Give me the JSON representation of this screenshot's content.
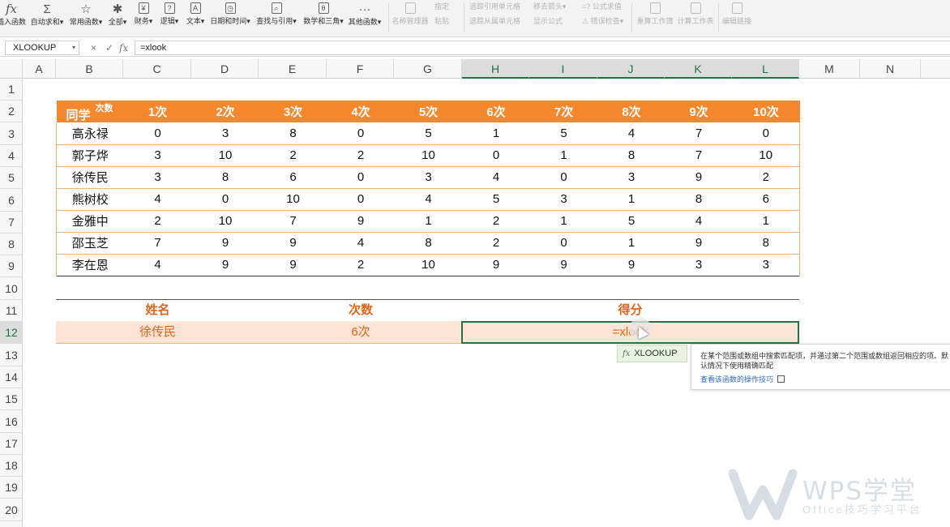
{
  "ribbon": {
    "items": [
      {
        "id": "insert_fn",
        "icon": "fx",
        "label": "插入函数"
      },
      {
        "id": "autosum",
        "icon": "Σ",
        "label": "自动求和▾"
      },
      {
        "id": "common",
        "icon": "☆",
        "label": "常用函数▾"
      },
      {
        "id": "all",
        "icon": "✱",
        "label": "全部▾"
      },
      {
        "id": "finance",
        "icon": "¥",
        "label": "财务▾"
      },
      {
        "id": "logic",
        "icon": "?",
        "label": "逻辑▾"
      },
      {
        "id": "text",
        "icon": "A",
        "label": "文本▾"
      },
      {
        "id": "datetime",
        "icon": "◷",
        "label": "日期和时间▾"
      },
      {
        "id": "lookup",
        "icon": "⌕",
        "label": "查找与引用▾"
      },
      {
        "id": "math",
        "icon": "θ",
        "label": "数学和三角▾"
      },
      {
        "id": "other",
        "icon": "···",
        "label": "其他函数▾"
      }
    ],
    "disabled": [
      {
        "id": "name_mgr",
        "label": "名称管理器"
      },
      {
        "id": "recalc",
        "label": "重算工作簿"
      },
      {
        "id": "calc_sheet",
        "label": "计算工作表"
      },
      {
        "id": "edit_links",
        "label": "编辑链接"
      }
    ],
    "small": {
      "specify": "指定",
      "paste": "粘贴",
      "trace_prec": "追踪引用单元格",
      "trace_dep": "追踪从属单元格",
      "remove_arrows": "移去箭头▾",
      "show_formula": "显示公式",
      "eval_formula": "=? 公式求值",
      "error_check": "⚠ 错误检查▾"
    }
  },
  "formula_bar": {
    "name_box": "XLOOKUP",
    "cancel": "×",
    "confirm": "✓",
    "fx": "fx",
    "formula": "=xlook"
  },
  "columns": [
    "A",
    "B",
    "C",
    "D",
    "E",
    "F",
    "G",
    "H",
    "I",
    "J",
    "K",
    "L",
    "M",
    "N"
  ],
  "rows": [
    "1",
    "2",
    "3",
    "4",
    "5",
    "6",
    "7",
    "8",
    "9",
    "10",
    "11",
    "12",
    "13",
    "14",
    "15",
    "16",
    "17",
    "18",
    "19",
    "20"
  ],
  "table": {
    "corner_main": "同学",
    "corner_sub": "次数",
    "headers": [
      "1次",
      "2次",
      "3次",
      "4次",
      "5次",
      "6次",
      "7次",
      "8次",
      "9次",
      "10次"
    ],
    "rows": [
      {
        "name": "高永禄",
        "scores": [
          0,
          3,
          8,
          0,
          5,
          1,
          5,
          4,
          7,
          0
        ]
      },
      {
        "name": "郭子烨",
        "scores": [
          3,
          10,
          2,
          2,
          10,
          0,
          1,
          8,
          7,
          10
        ]
      },
      {
        "name": "徐传民",
        "scores": [
          3,
          8,
          6,
          0,
          3,
          4,
          0,
          3,
          9,
          2
        ]
      },
      {
        "name": "熊树校",
        "scores": [
          4,
          0,
          10,
          0,
          4,
          5,
          3,
          1,
          8,
          6
        ]
      },
      {
        "name": "金雅中",
        "scores": [
          2,
          10,
          7,
          9,
          1,
          2,
          1,
          5,
          4,
          1
        ]
      },
      {
        "name": "邵玉芝",
        "scores": [
          7,
          9,
          9,
          4,
          8,
          2,
          0,
          1,
          9,
          8
        ]
      },
      {
        "name": "李在恩",
        "scores": [
          4,
          9,
          9,
          2,
          10,
          9,
          9,
          9,
          3,
          3
        ]
      }
    ]
  },
  "lookup": {
    "name_label": "姓名",
    "count_label": "次数",
    "score_label": "得分",
    "name_value": "徐传民",
    "count_value": "6次",
    "typing": "=xlook"
  },
  "autocomplete": {
    "fx": "fx",
    "item": "XLOOKUP",
    "description": "在某个范围或数组中搜索匹配项，并通过第二个范围或数组返回相应的项。默认情况下使用精确匹配",
    "link": "查看该函数的操作技巧"
  },
  "watermark": {
    "brand": "WPS学堂",
    "tagline": "Office技巧学习平台"
  },
  "colors": {
    "header_orange": "#f5882c",
    "accent_orange": "#e0651a",
    "active_green": "#217346"
  }
}
